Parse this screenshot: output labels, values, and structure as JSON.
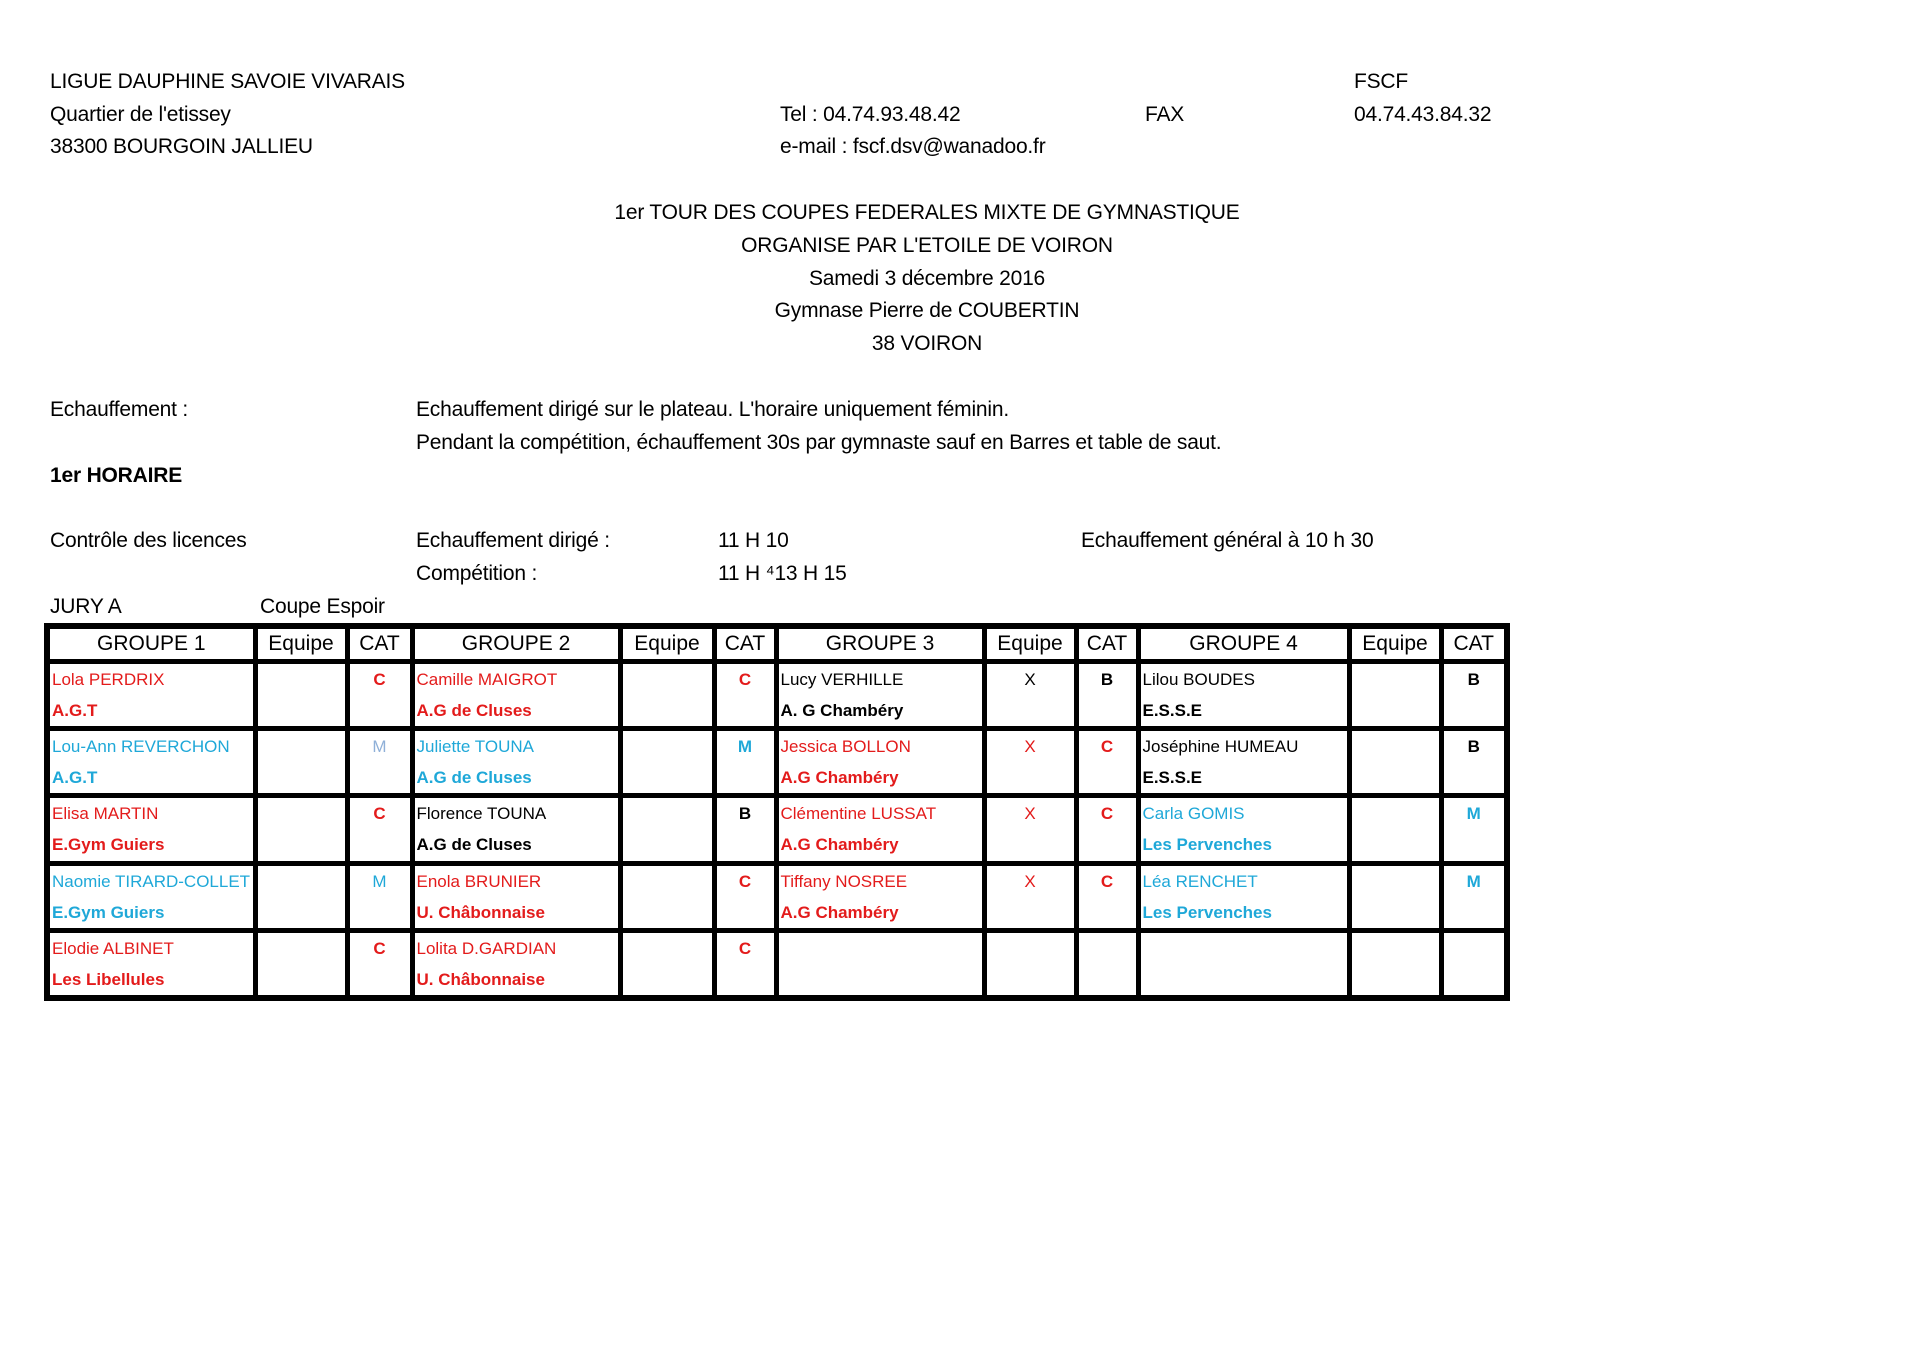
{
  "header": {
    "org_name": "LIGUE DAUPHINE SAVOIE VIVARAIS",
    "address_line1": "Quartier de l'etissey",
    "address_line2": "38300 BOURGOIN JALLIEU",
    "tel": "Tel : 04.74.93.48.42",
    "email": "e-mail : fscf.dsv@wanadoo.fr",
    "fax_label": "FAX",
    "fscf_label": "FSCF",
    "fax_number": "04.74.43.84.32"
  },
  "title": {
    "line1": "1er TOUR DES COUPES FEDERALES MIXTE DE GYMNASTIQUE",
    "line2": "ORGANISE PAR L'ETOILE DE VOIRON",
    "line3": "Samedi 3 décembre 2016",
    "line4": "Gymnase Pierre de COUBERTIN",
    "line5": "38 VOIRON"
  },
  "warmup": {
    "label": "Echauffement :",
    "text1": "Echauffement dirigé sur le plateau. L'horaire uniquement féminin.",
    "text2": "Pendant la compétition, échauffement 30s par gymnaste sauf en Barres et table de saut."
  },
  "schedule": {
    "heading": "1er HORAIRE",
    "licence_check": "Contrôle des licences",
    "guided_warmup_label": "Echauffement dirigé :",
    "guided_warmup_time": "11 H 10",
    "competition_label": "Compétition :",
    "competition_time": "11 H ⁴13 H 15",
    "general_warmup": "Echauffement général à 10 h 30",
    "jury": "JURY A",
    "cup": "Coupe Espoir"
  },
  "colors": {
    "red": "#e31b1b",
    "blue": "#1fa8d8",
    "light_blue": "#8fb0d8",
    "black": "#000000"
  },
  "table": {
    "headers": [
      "GROUPE 1",
      "Equipe",
      "CAT",
      "GROUPE 2",
      "Equipe",
      "CAT",
      "GROUPE 3",
      "Equipe",
      "CAT",
      "GROUPE 4",
      "Equipe",
      "CAT"
    ],
    "rows": [
      [
        {
          "name": "Lola PERDRIX",
          "club": "A.G.T",
          "equipe": "",
          "cat": "C",
          "color": "red"
        },
        {
          "name": "Camille MAIGROT",
          "club": "A.G de Cluses",
          "equipe": "",
          "cat": "C",
          "color": "red"
        },
        {
          "name": "Lucy VERHILLE",
          "club": "A. G  Chambéry",
          "equipe": "X",
          "cat": "B",
          "color": "black"
        },
        {
          "name": "Lilou BOUDES",
          "club": "E.S.S.E",
          "equipe": "",
          "cat": "B",
          "color": "black"
        }
      ],
      [
        {
          "name": "Lou-Ann REVERCHON",
          "club": "A.G.T",
          "equipe": "",
          "cat": "M",
          "color": "blue",
          "cat_color": "lightblue"
        },
        {
          "name": "Juliette TOUNA",
          "club": "A.G de Cluses",
          "equipe": "",
          "cat": "M",
          "color": "blue"
        },
        {
          "name": "Jessica BOLLON",
          "club": "A.G Chambéry",
          "equipe": "X",
          "cat": "C",
          "color": "red"
        },
        {
          "name": "Joséphine HUMEAU",
          "club": "E.S.S.E",
          "equipe": "",
          "cat": "B",
          "color": "black"
        }
      ],
      [
        {
          "name": "Elisa MARTIN",
          "club": "E.Gym Guiers",
          "equipe": "",
          "cat": "C",
          "color": "red"
        },
        {
          "name": "Florence TOUNA",
          "club": "A.G de Cluses",
          "equipe": "",
          "cat": "B",
          "color": "black"
        },
        {
          "name": "Clémentine LUSSAT",
          "club": "A.G Chambéry",
          "equipe": "X",
          "cat": "C",
          "color": "red"
        },
        {
          "name": "Carla GOMIS",
          "club": "Les Pervenches",
          "equipe": "",
          "cat": "M",
          "color": "blue"
        }
      ],
      [
        {
          "name": "Naomie TIRARD-COLLET",
          "club": "E.Gym Guiers",
          "equipe": "",
          "cat": "M",
          "color": "blue"
        },
        {
          "name": "Enola BRUNIER",
          "club": "U. Châbonnaise",
          "equipe": "",
          "cat": "C",
          "color": "red"
        },
        {
          "name": "Tiffany NOSREE",
          "club": "A.G Chambéry",
          "equipe": "X",
          "cat": "C",
          "color": "red"
        },
        {
          "name": "Léa RENCHET",
          "club": "Les Pervenches",
          "equipe": "",
          "cat": "M",
          "color": "blue"
        }
      ],
      [
        {
          "name": "Elodie ALBINET",
          "club": "Les Libellules",
          "equipe": "",
          "cat": "C",
          "color": "red"
        },
        {
          "name": "Lolita D.GARDIAN",
          "club": "U. Châbonnaise",
          "equipe": "",
          "cat": "C",
          "color": "red"
        },
        {
          "name": "",
          "club": "",
          "equipe": "",
          "cat": "",
          "color": "black"
        },
        {
          "name": "",
          "club": "",
          "equipe": "",
          "cat": "",
          "color": "black"
        }
      ]
    ]
  }
}
